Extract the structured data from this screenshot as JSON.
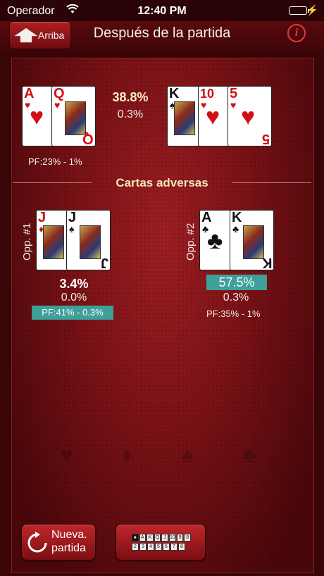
{
  "status": {
    "carrier": "Operador",
    "time": "12:40 PM"
  },
  "nav": {
    "up_label": "Arriba",
    "title": "Después de la partida",
    "info": "i"
  },
  "player": {
    "hole_cards": [
      {
        "rank": "A",
        "suit": "♥"
      },
      {
        "rank": "Q",
        "suit": "♥"
      }
    ],
    "win_pct": "38.8%",
    "tie_pct": "0.3%",
    "pf": "PF:23% - 1%"
  },
  "board": [
    {
      "rank": "K",
      "suit": "♠"
    },
    {
      "rank": "10",
      "suit": "♥"
    },
    {
      "rank": "5",
      "suit": "♥"
    }
  ],
  "section_title": "Cartas adversas",
  "opponents": [
    {
      "label": "Opp. #1",
      "cards": [
        {
          "rank": "J",
          "suit": "♦"
        },
        {
          "rank": "J",
          "suit": "♠"
        }
      ],
      "win_pct": "3.4%",
      "tie_pct": "0.0%",
      "pf": "PF:41% - 0.3%"
    },
    {
      "label": "Opp. #2",
      "cards": [
        {
          "rank": "A",
          "suit": "♣"
        },
        {
          "rank": "K",
          "suit": "♣"
        }
      ],
      "win_pct": "57.5%",
      "tie_pct": "0.3%",
      "pf": "PF:35% - 1%"
    }
  ],
  "suits_row": [
    "♥",
    "♦",
    "♠",
    "♣"
  ],
  "buttons": {
    "new_game_line1": "Nueva.",
    "new_game_line2": "partida",
    "ranking_row1": [
      "A",
      "K",
      "Q",
      "J",
      "10",
      "9",
      "8"
    ],
    "ranking_row2": [
      "2",
      "3",
      "4",
      "5",
      "6",
      "7",
      "8"
    ]
  },
  "colors": {
    "felt": "#7a1216",
    "highlight": "#3f9f9a",
    "suit_red": "#d10f14"
  }
}
